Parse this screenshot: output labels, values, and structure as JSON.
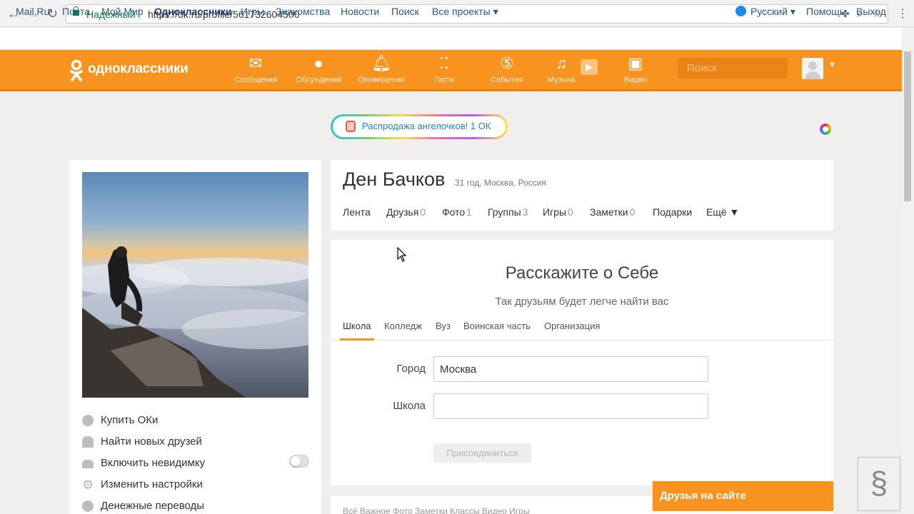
{
  "browser": {
    "secure_label": "Надежный",
    "url": "https://ok.ru/profile/561732604500"
  },
  "portal": {
    "links": [
      "Mail.Ru",
      "Почта",
      "Мой Мир",
      "Одноклассники",
      "Игры",
      "Знакомства",
      "Новости",
      "Поиск",
      "Все проекты ▾"
    ],
    "language": "Русский ▾",
    "help": "Помощь",
    "logout": "Выход"
  },
  "header": {
    "logo": "одноклассники",
    "nav": [
      {
        "label": "Сообщения",
        "icon": "envelope-icon"
      },
      {
        "label": "Обсуждения",
        "icon": "chat-bubbles-icon"
      },
      {
        "label": "Оповещения",
        "icon": "bell-icon"
      },
      {
        "label": "Гости",
        "icon": "footprints-icon"
      },
      {
        "label": "События",
        "icon": "events-icon"
      },
      {
        "label": "Музыка",
        "icon": "music-note-icon"
      },
      {
        "label": "Видео",
        "icon": "video-camera-icon"
      }
    ],
    "search_placeholder": "Поиск",
    "accent": "#f7931e"
  },
  "promo": {
    "text": "Распродажа ангелочков! 1 ОК"
  },
  "left_menu": [
    {
      "label": "Купить ОКи",
      "icon": "ok-coin-icon"
    },
    {
      "label": "Найти новых друзей",
      "icon": "person-icon"
    },
    {
      "label": "Включить невидимку",
      "icon": "hat-icon"
    },
    {
      "label": "Изменить настройки",
      "icon": "gear-icon"
    },
    {
      "label": "Денежные переводы",
      "icon": "money-transfer-icon"
    }
  ],
  "profile": {
    "name": "Ден Бачков",
    "meta": "31 год, Москва, Россия",
    "tabs": [
      {
        "label": "Лента",
        "count": ""
      },
      {
        "label": "Друзья",
        "count": "0"
      },
      {
        "label": "Фото",
        "count": "1"
      },
      {
        "label": "Группы",
        "count": "3"
      },
      {
        "label": "Игры",
        "count": "0"
      },
      {
        "label": "Заметки",
        "count": "0"
      },
      {
        "label": "Подарки",
        "count": ""
      },
      {
        "label": "Ещё ▼",
        "count": ""
      }
    ]
  },
  "about": {
    "title": "Расскажите о Себе",
    "subtitle": "Так друзьям будет легче найти вас",
    "tabs": [
      "Школа",
      "Колледж",
      "Вуз",
      "Воинская часть",
      "Организация"
    ],
    "city_label": "Город",
    "city_value": "Москва",
    "school_label": "Школа",
    "school_value": "",
    "join_button": "Присоединиться"
  },
  "bottom_tabs": "Всё   Важное   Фото   Заметки   Классы   Видео   Игры",
  "friends_bar": "Друзья на сайте"
}
